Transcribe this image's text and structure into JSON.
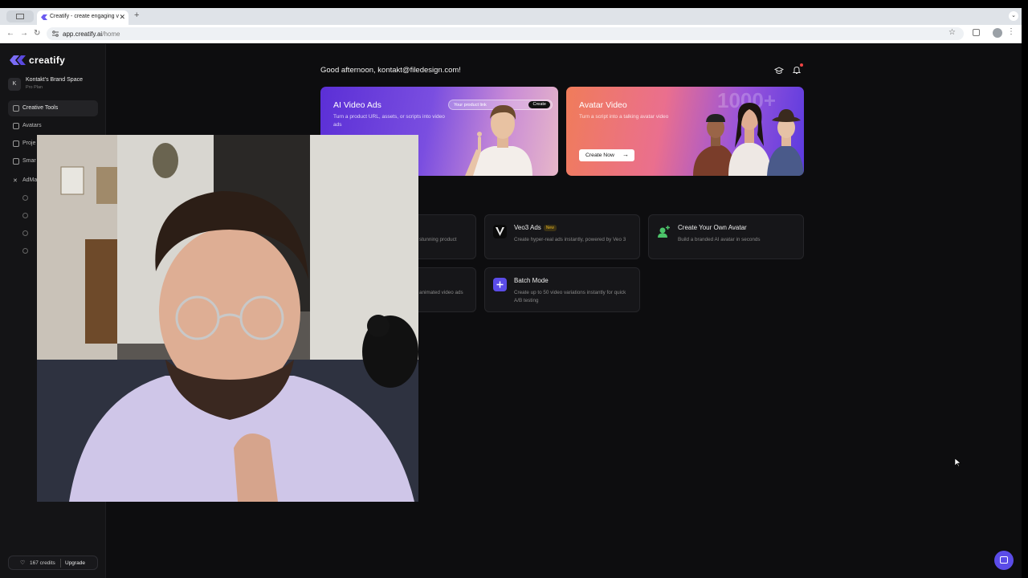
{
  "browser": {
    "tab_title": "Creatify - create engaging v",
    "url_host": "app.creatify.ai",
    "url_path": "/home"
  },
  "sidebar": {
    "logo": "creatify",
    "brand_name": "Kontakt's Brand Space",
    "brand_plan": "Pro Plan",
    "brand_initial": "K",
    "items": [
      {
        "label": "Creative Tools"
      },
      {
        "label": "Avatars"
      },
      {
        "label": "Proje"
      },
      {
        "label": "Smar"
      },
      {
        "label": "AdMa"
      }
    ],
    "credits_count": "167 credits",
    "upgrade_label": "Upgrade"
  },
  "main": {
    "greeting": "Good afternoon, kontakt@filedesign.com!",
    "hero_ai": {
      "title": "AI Video Ads",
      "desc": "Turn a product URL, assets, or scripts into video ads",
      "input_placeholder": "Your product link",
      "create_label": "Create"
    },
    "hero_avatar": {
      "title": "Avatar Video",
      "desc": "Turn a script into a talking avatar video",
      "big_number": "1000+",
      "cta_label": "Create Now"
    },
    "cards": [
      {
        "title": "",
        "desc": "stunning product"
      },
      {
        "title": "Veo3 Ads",
        "badge": "New",
        "desc": "Create hyper-real ads instantly, powered by Veo 3"
      },
      {
        "title": "Create Your Own Avatar",
        "desc": "Build a branded AI avatar in seconds"
      },
      {
        "title": "",
        "desc": "animated video ads"
      },
      {
        "title": "Batch Mode",
        "desc": "Create up to 50 video variations instantly for quick A/B testing"
      }
    ]
  },
  "colors": {
    "accent": "#5b4ce8",
    "background": "#0d0d0f",
    "sidebar": "#141416",
    "notification": "#f04444"
  }
}
